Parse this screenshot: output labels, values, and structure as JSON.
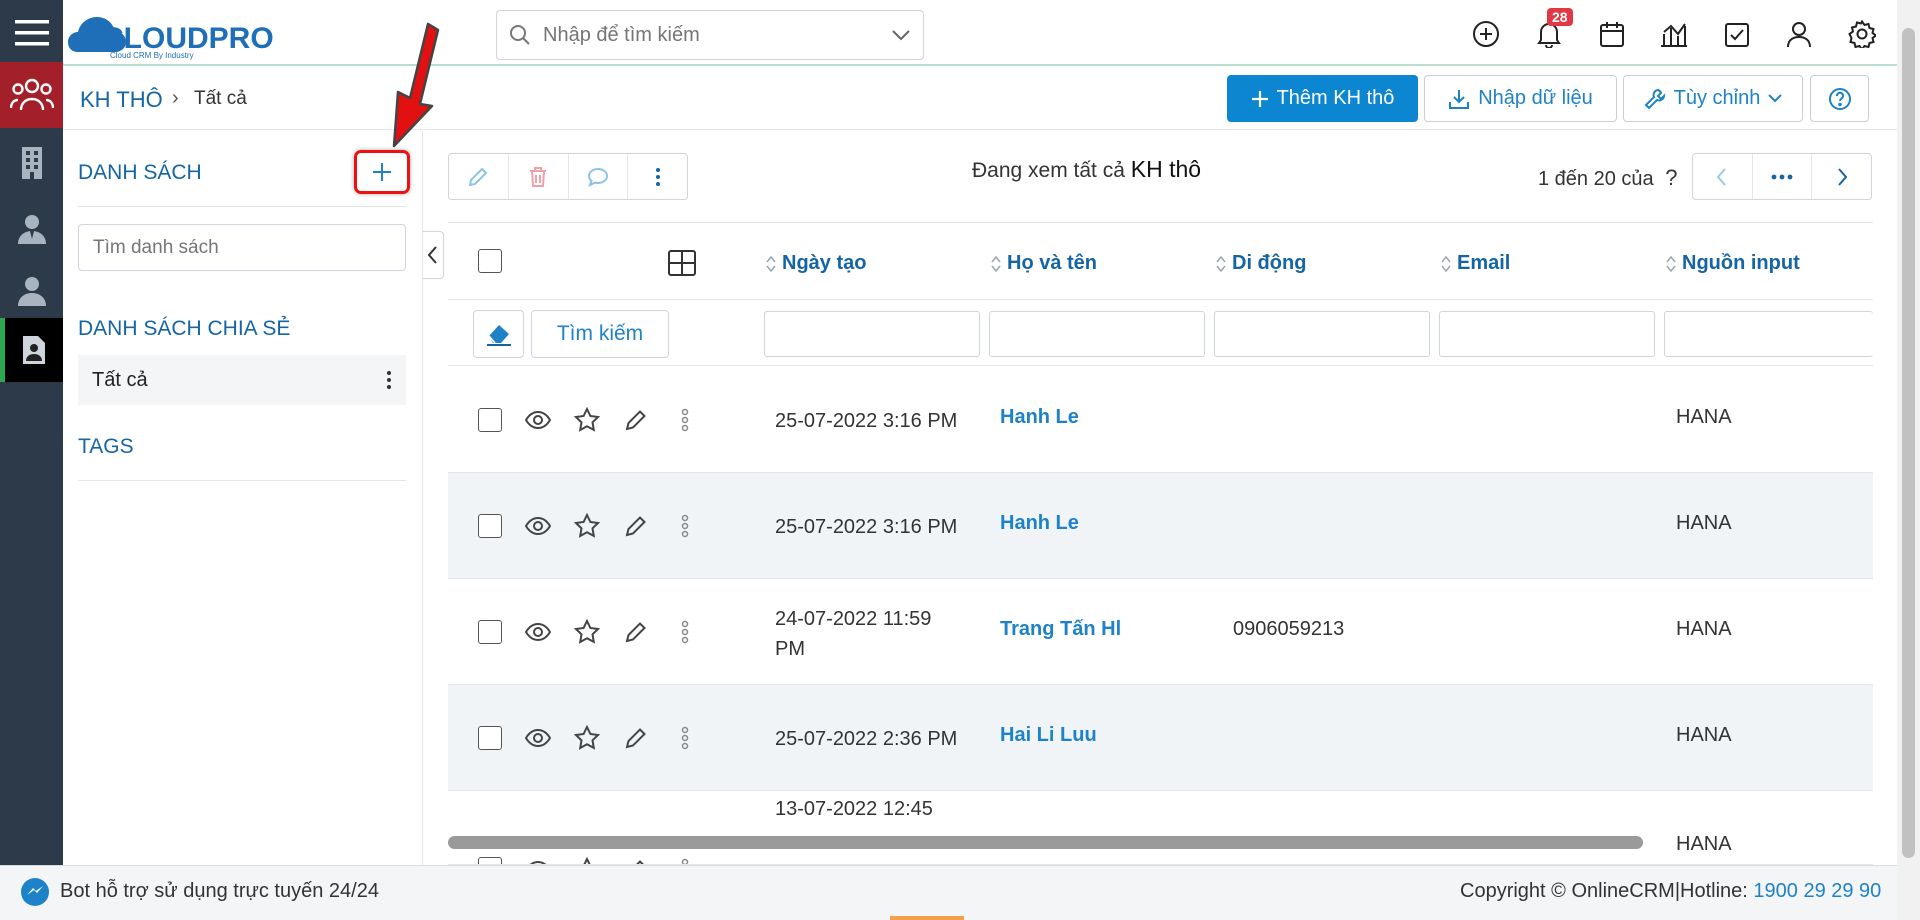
{
  "app": {
    "logo_text": "CLOUDPRO",
    "logo_tagline": "Cloud CRM By Industry"
  },
  "topbar": {
    "search_placeholder": "Nhập để tìm kiếm",
    "notification_count": "28"
  },
  "rail": {
    "items": [
      "menu-icon",
      "leads-icon",
      "building-icon",
      "contact-icon",
      "person-icon",
      "list-icon"
    ]
  },
  "breadcrumb": {
    "module": "KH THÔ",
    "separator": "›",
    "current": "Tất cả"
  },
  "header_buttons": {
    "add_lead": "Thêm KH thô",
    "import": "Nhập dữ liệu",
    "customize": "Tùy chỉnh"
  },
  "left_panel": {
    "lists_title": "DANH SÁCH",
    "list_search_placeholder": "Tìm danh sách",
    "shared_title": "DANH SÁCH CHIA SẺ",
    "shared_items": [
      {
        "label": "Tất cả"
      }
    ],
    "tags_title": "TAGS"
  },
  "list_view": {
    "viewing_prefix": "Đang xem tất cả",
    "viewing_module": "KH thô",
    "page_info": "1 đến 20 của",
    "page_info_suffix": "?",
    "search_button": "Tìm kiếm",
    "columns": [
      "Ngày tạo",
      "Họ và tên",
      "Di động",
      "Email",
      "Nguồn input"
    ],
    "rows": [
      {
        "date_line1": "25-07-2022 3:16 PM",
        "date_line2": "",
        "name": "Hanh Le",
        "phone": "",
        "email": "",
        "source": "HANA"
      },
      {
        "date_line1": "25-07-2022 3:16 PM",
        "date_line2": "",
        "name": "Hanh Le",
        "phone": "",
        "email": "",
        "source": "HANA"
      },
      {
        "date_line1": "24-07-2022 11:59",
        "date_line2": "PM",
        "name": "Trang Tấn Hl",
        "phone": "0906059213",
        "email": "",
        "source": "HANA"
      },
      {
        "date_line1": "25-07-2022 2:36 PM",
        "date_line2": "",
        "name": "Hai Li Luu",
        "phone": "",
        "email": "",
        "source": "HANA"
      },
      {
        "date_line1": "13-07-2022 12:45",
        "date_line2": "",
        "name": "",
        "phone": "",
        "email": "",
        "source": "HANA"
      }
    ]
  },
  "footer": {
    "bot_text": "Bot hỗ trợ sử dụng trực tuyến 24/24",
    "copyright": "Copyright © OnlineCRM",
    "hotline_label": "|Hotline:",
    "hotline_number": "1900 29 29 90"
  },
  "colors": {
    "primary": "#0c86d1",
    "link": "#1e82c8",
    "heading": "#1565a5",
    "rail_bg": "#2d3a4a",
    "rail_active": "#a31f2a",
    "annotation_red": "#e11111"
  }
}
